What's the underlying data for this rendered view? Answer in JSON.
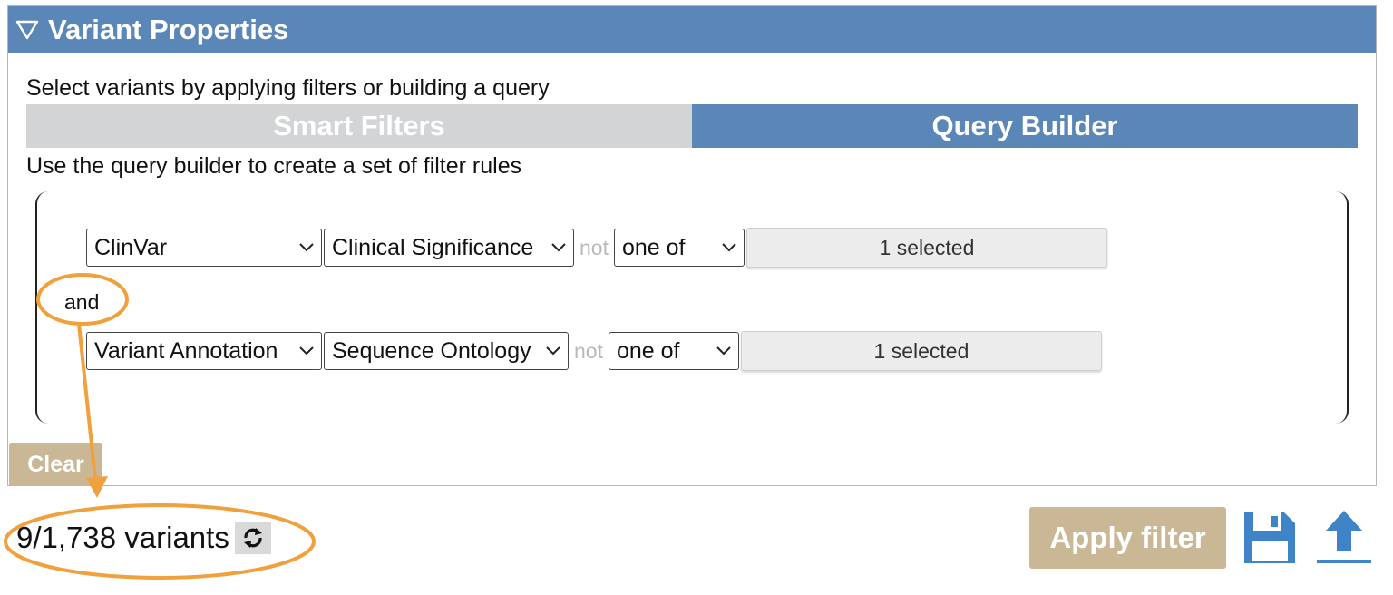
{
  "panel": {
    "title": "Variant Properties",
    "intro": "Select variants by applying filters or building a query",
    "tabs": [
      {
        "label": "Smart Filters",
        "active": false
      },
      {
        "label": "Query Builder",
        "active": true
      }
    ],
    "query_builder_text": "Use the query builder to create a set of filter rules"
  },
  "rules": [
    {
      "source": "ClinVar",
      "field": "Clinical Significance",
      "not": "not",
      "operator": "one of",
      "value": "1 selected"
    },
    {
      "source": "Variant Annotation",
      "field": "Sequence Ontology",
      "not": "not",
      "operator": "one of",
      "value": "1 selected"
    }
  ],
  "conjunction": "and",
  "clear_label": "Clear",
  "variant_count": "9/1,738 variants",
  "apply_label": "Apply filter",
  "icons": {
    "collapse": "triangle-down-outline-icon",
    "refresh": "refresh-icon",
    "save": "floppy-disk-icon",
    "upload": "upload-arrow-icon",
    "dropdown": "chevron-down-icon"
  },
  "colors": {
    "header": "#5b86b8",
    "tab_inactive": "#d3d4d6",
    "button": "#c9b796",
    "annotation": "#f0a03c"
  }
}
